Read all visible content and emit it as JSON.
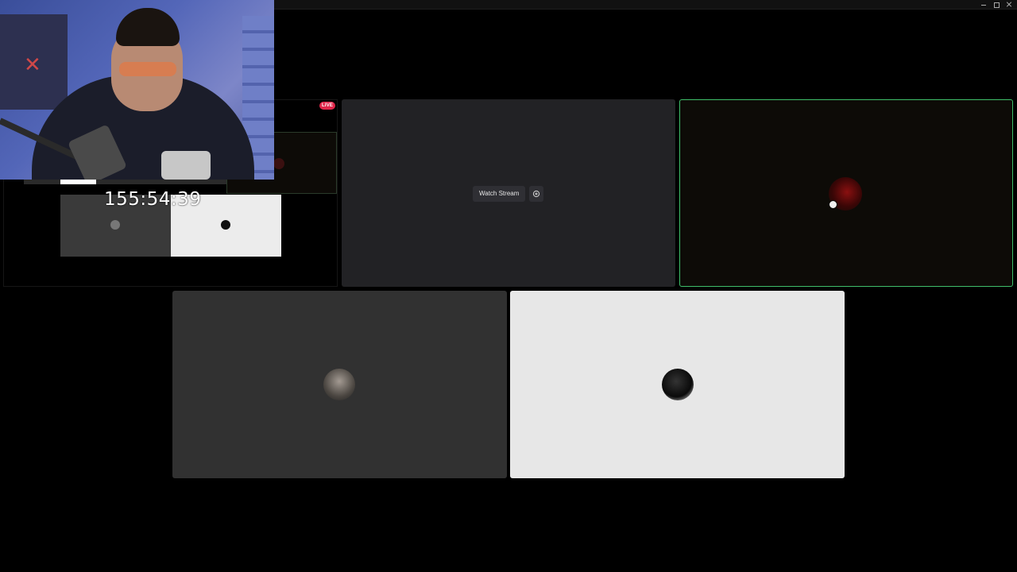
{
  "window": {
    "controls": {
      "minimize": "minimize-icon",
      "maximize": "maximize-icon",
      "close": "close-icon"
    }
  },
  "preview": {
    "live_badge": "LIVE"
  },
  "overlay": {
    "timer": "155:54:39"
  },
  "stream_tile": {
    "watch_label": "Watch Stream",
    "popout_icon": "popout-icon"
  },
  "colors": {
    "speaking_border": "#3fbf6a",
    "live_badge": "#e0264a",
    "stream_tile_bg": "#222225",
    "gray_tile_bg": "#313131",
    "white_tile_bg": "#e7e7e7"
  }
}
